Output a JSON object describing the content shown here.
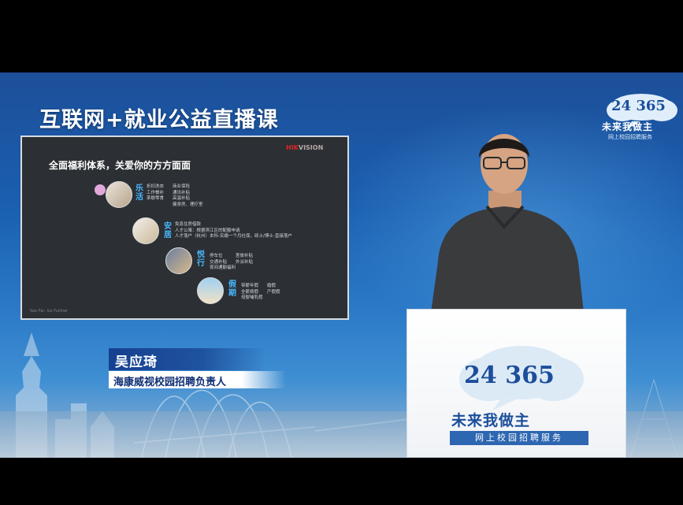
{
  "broadcast": {
    "title": "互联网+就业公益直播课"
  },
  "logo": {
    "number": "24 365",
    "slogan": "未来我做主",
    "sub": "网上校园招聘服务"
  },
  "slide": {
    "brand_prefix": "HIK",
    "brand_suffix": "VISION",
    "heading": "全面福利体系，关爱你的方方面面",
    "footer": "See Far, Go Further",
    "sections": [
      {
        "category": "乐活",
        "lines": [
          "折扣洗衣　　商业保险",
          "工作餐补　　通讯补贴",
          "茶歇零食　　高温补贴",
          "　　　　　　健身房、理疗室"
        ]
      },
      {
        "category": "安居",
        "lines": [
          "免息住房借款",
          "人才公寓：根据滨江区的配额申请",
          "人才落户（杭州）本科-实缴一个月社保，硕士/博士-直接落户"
        ]
      },
      {
        "category": "悦行",
        "lines": [
          "停车位　　　差旅补贴",
          "交通补贴　　外派补贴",
          "夜间通勤福利"
        ]
      },
      {
        "category": "假期",
        "lines": [
          "带薪年假　　婚假",
          "全薪病假　　产假假",
          "母婴哺乳假"
        ]
      }
    ]
  },
  "speaker": {
    "name": "吴应琦",
    "title": "海康威视校园招聘负责人"
  },
  "colors": {
    "brand_blue": "#1b4e9b",
    "slide_bg": "#2c2f33",
    "category_blue": "#48b8ff",
    "studio_blue": "#1a5fb0"
  }
}
